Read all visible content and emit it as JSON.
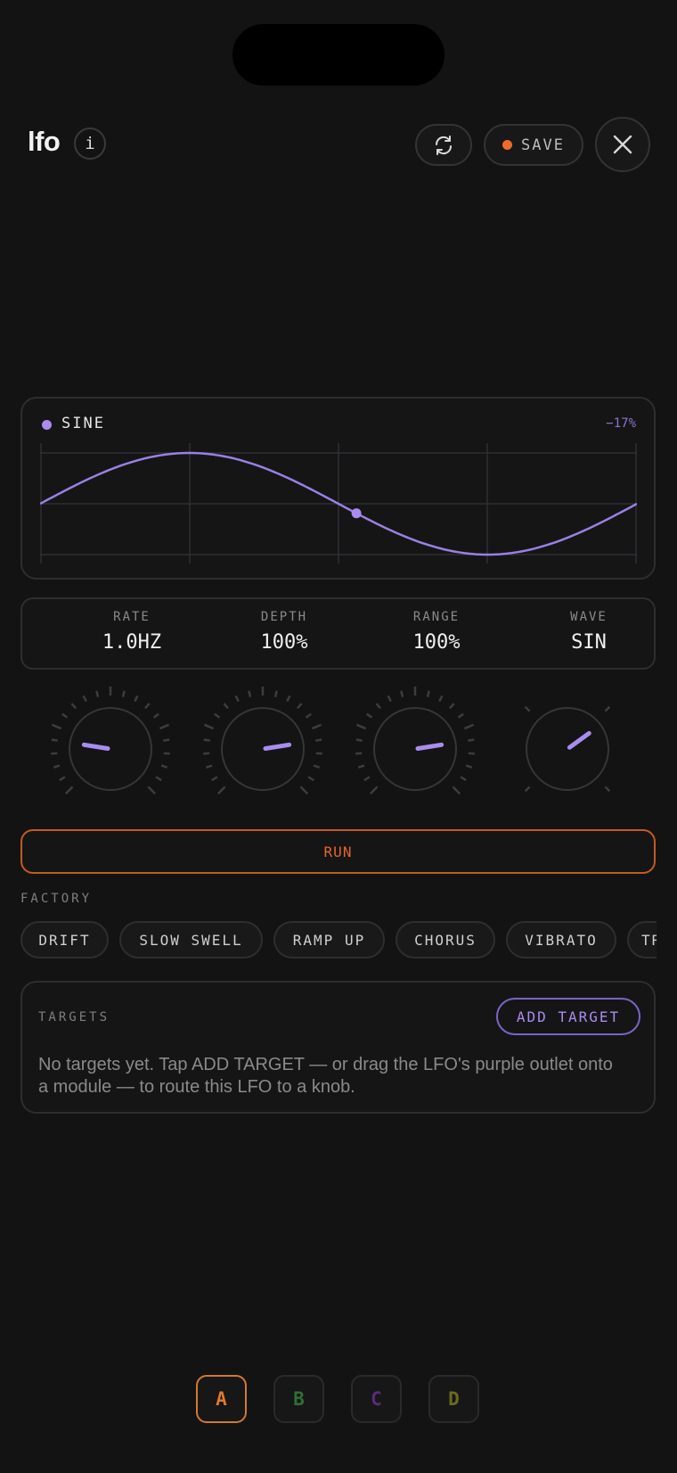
{
  "header": {
    "title": "lfo",
    "info_label": "i",
    "save_label": "SAVE",
    "icons": [
      "info-icon",
      "refresh-icon",
      "close-icon"
    ]
  },
  "scope": {
    "wave_name": "SINE",
    "current_value": "−17%",
    "phase_marker": 0.53,
    "accent_color": "#a98cf0"
  },
  "params": [
    {
      "label": "RATE",
      "value": "1.0HZ"
    },
    {
      "label": "DEPTH",
      "value": "100%"
    },
    {
      "label": "RANGE",
      "value": "100%"
    },
    {
      "label": "WAVE",
      "value": "SIN"
    }
  ],
  "knobs": [
    {
      "name": "rate",
      "level": 0.2
    },
    {
      "name": "depth",
      "level": 0.8
    },
    {
      "name": "range",
      "level": 0.8
    },
    {
      "name": "wave",
      "level": 0.7
    }
  ],
  "run_label": "RUN",
  "factory": {
    "label": "FACTORY",
    "presets": [
      "DRIFT",
      "SLOW SWELL",
      "RAMP UP",
      "CHORUS",
      "VIBRATO",
      "TR"
    ]
  },
  "targets": {
    "label": "TARGETS",
    "add_label": "ADD TARGET",
    "empty_message": "No targets yet. Tap ADD TARGET — or drag the LFO's purple outlet onto a module — to route this LFO to a knob."
  },
  "banks": [
    {
      "label": "A",
      "color": "#e07a2c",
      "active": true
    },
    {
      "label": "B",
      "color": "#2f6f33",
      "active": false
    },
    {
      "label": "C",
      "color": "#5a2a78",
      "active": false
    },
    {
      "label": "D",
      "color": "#6b6a22",
      "active": false
    }
  ],
  "colors": {
    "accent_orange": "#f06a2a",
    "accent_purple": "#a98cf0"
  }
}
